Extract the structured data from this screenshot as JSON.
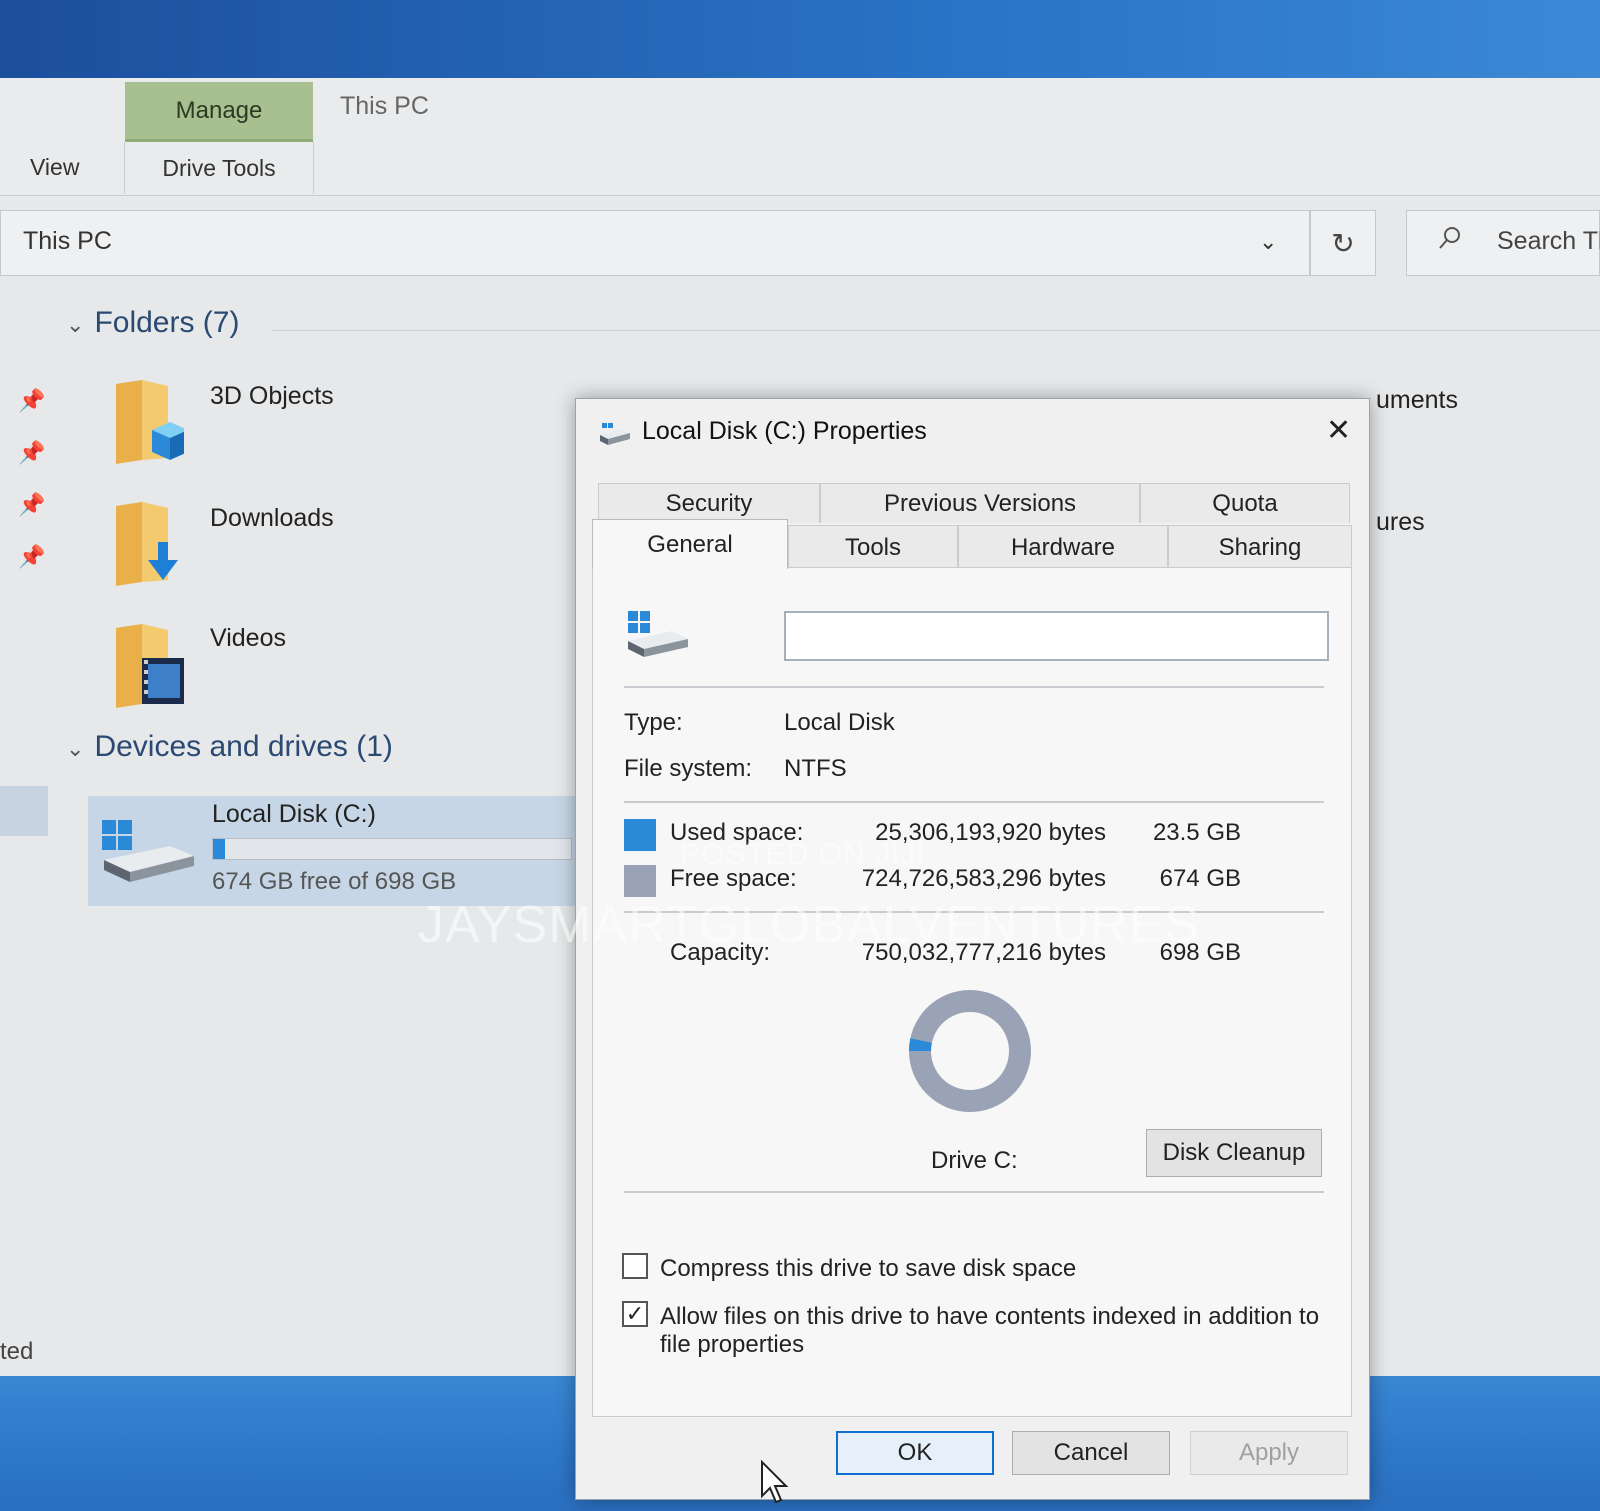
{
  "explorer": {
    "ribbon": {
      "manage_tab": "Manage",
      "thispc_tab": "This PC",
      "view_tab": "View",
      "drive_tools_tab": "Drive Tools"
    },
    "address": {
      "path": "This PC",
      "search_placeholder": "Search Tl"
    },
    "groups": {
      "folders": "Folders (7)",
      "devices": "Devices and drives (1)"
    },
    "folders": [
      {
        "label": "3D Objects",
        "icon": "3d-objects-icon"
      },
      {
        "label": "Downloads",
        "icon": "downloads-icon"
      },
      {
        "label": "Videos",
        "icon": "videos-icon"
      }
    ],
    "partial_labels": {
      "documents": "uments",
      "pictures": "ures"
    },
    "drive": {
      "name": "Local Disk (C:)",
      "free_text": "674 GB free of 698 GB",
      "used_fraction": 0.034
    },
    "status_fragment": "ted"
  },
  "dialog": {
    "title": "Local Disk (C:) Properties",
    "tabs_row1": [
      "Security",
      "Previous Versions",
      "Quota"
    ],
    "tabs_row2": [
      "General",
      "Tools",
      "Hardware",
      "Sharing"
    ],
    "active_tab": "General",
    "label_value": "",
    "type_label": "Type:",
    "type_value": "Local Disk",
    "fs_label": "File system:",
    "fs_value": "NTFS",
    "used_label": "Used space:",
    "used_bytes": "25,306,193,920 bytes",
    "used_gb": "23.5 GB",
    "free_label": "Free space:",
    "free_bytes": "724,726,583,296 bytes",
    "free_gb": "674 GB",
    "capacity_label": "Capacity:",
    "capacity_bytes": "750,032,777,216 bytes",
    "capacity_gb": "698 GB",
    "drive_caption": "Drive C:",
    "disk_cleanup_button": "Disk Cleanup",
    "compress_label": "Compress this drive to save disk space",
    "compress_checked": false,
    "index_label_line1": "Allow files on this drive to have contents indexed in addition to",
    "index_label_line2": "file properties",
    "index_checked": true,
    "ok_button": "OK",
    "cancel_button": "Cancel",
    "apply_button": "Apply",
    "used_fraction": 0.0337,
    "colors": {
      "used": "#2a8ad8",
      "free": "#9aa3b6"
    }
  },
  "watermark": {
    "line1": "POSTED ON JIJI",
    "line2": "JAYSMARTGLOBALVENTURES"
  }
}
